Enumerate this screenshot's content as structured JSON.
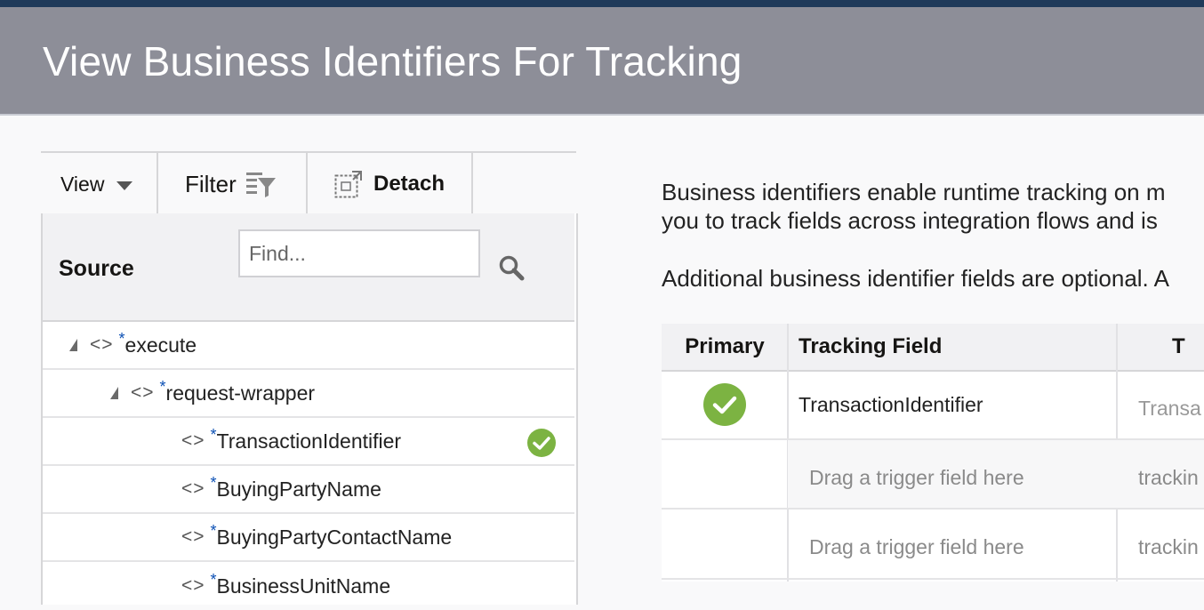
{
  "page": {
    "title": "View Business Identifiers For Tracking"
  },
  "toolbar": {
    "view_label": "View",
    "filter_label": "Filter",
    "detach_label": "Detach"
  },
  "source_panel": {
    "heading": "Source",
    "search_placeholder": "Find...",
    "tree": [
      {
        "name": "execute",
        "required_marker": "*",
        "expanded": true
      },
      {
        "name": "request-wrapper",
        "required_marker": "*",
        "expanded": true
      },
      {
        "name": "TransactionIdentifier",
        "required_marker": "*",
        "selected": true
      },
      {
        "name": "BuyingPartyName",
        "required_marker": "*"
      },
      {
        "name": "BuyingPartyContactName",
        "required_marker": "*"
      },
      {
        "name": "BusinessUnitName",
        "required_marker": "*"
      }
    ]
  },
  "description": {
    "line1": "Business identifiers enable runtime tracking on m",
    "line2": "you to track fields across integration flows and is",
    "line3": "Additional business identifier fields are optional. A"
  },
  "tracking_table": {
    "headers": {
      "primary": "Primary",
      "tracking_field": "Tracking Field",
      "third": "T"
    },
    "rows": [
      {
        "primary": true,
        "tracking_field": "TransactionIdentifier",
        "third": "Transa"
      },
      {
        "primary": false,
        "tracking_field": "Drag a trigger field here",
        "third": "trackin"
      },
      {
        "primary": false,
        "tracking_field": "Drag a trigger field here",
        "third": "trackin"
      }
    ]
  },
  "colors": {
    "header_bg": "#8d8e98",
    "check_green": "#7cb342",
    "required_star": "#0b4fb4"
  }
}
